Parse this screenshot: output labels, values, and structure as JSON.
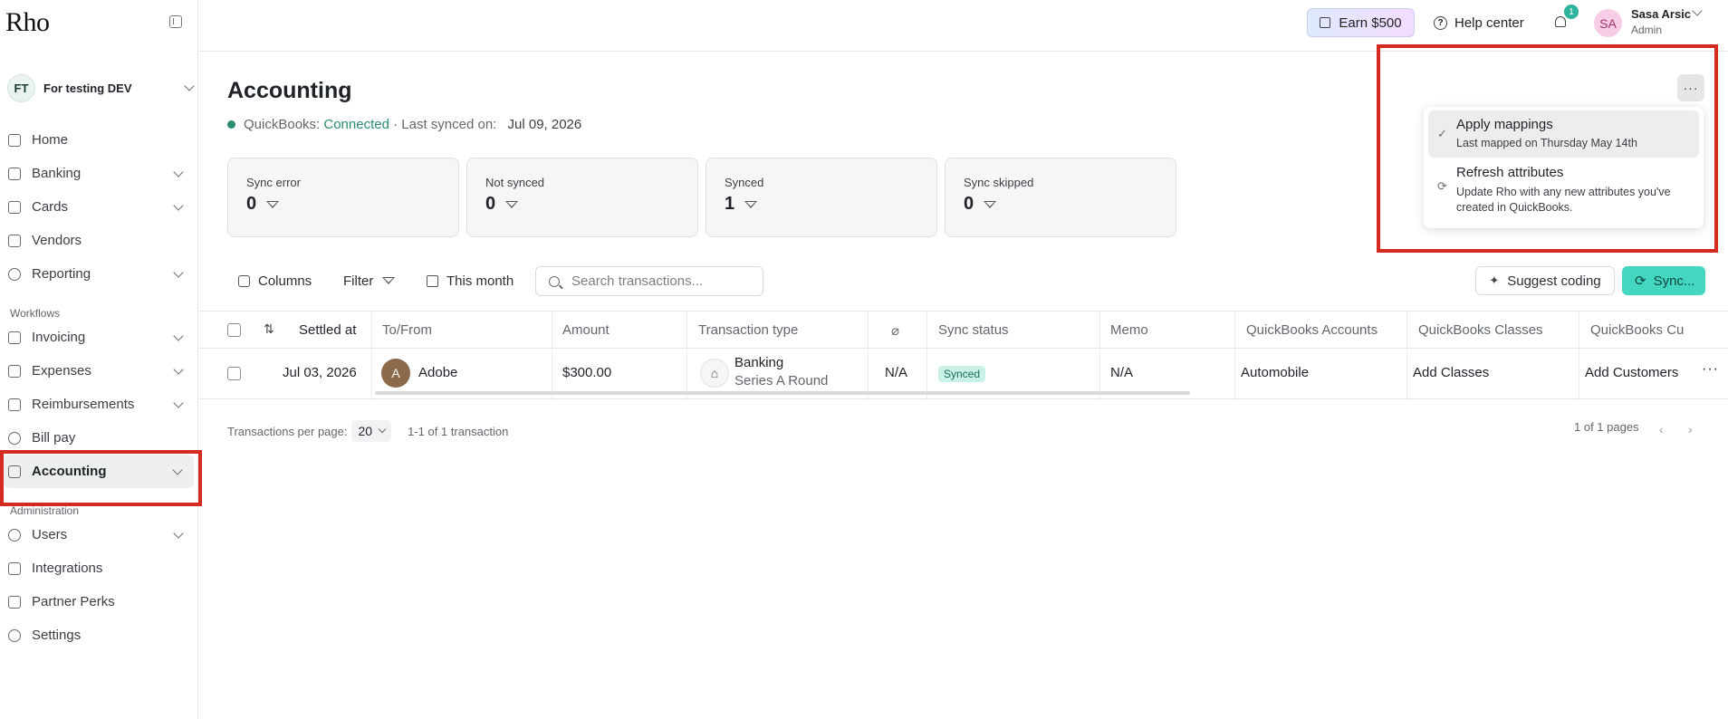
{
  "app": {
    "logo": "Rho"
  },
  "org": {
    "initials": "FT",
    "name": "For testing DEV"
  },
  "sidebar": {
    "items": [
      {
        "label": "Home"
      },
      {
        "label": "Banking"
      },
      {
        "label": "Cards"
      },
      {
        "label": "Vendors"
      },
      {
        "label": "Reporting"
      }
    ],
    "workflows_label": "Workflows",
    "workflow_items": [
      {
        "label": "Invoicing"
      },
      {
        "label": "Expenses"
      },
      {
        "label": "Reimbursements"
      },
      {
        "label": "Bill pay"
      },
      {
        "label": "Accounting"
      }
    ],
    "admin_label": "Administration",
    "admin_items": [
      {
        "label": "Users"
      },
      {
        "label": "Integrations"
      },
      {
        "label": "Partner Perks"
      },
      {
        "label": "Settings"
      }
    ]
  },
  "topbar": {
    "earn_label": "Earn $500",
    "help_label": "Help center",
    "notification_count": "1",
    "user_initials": "SA",
    "user_name": "Sasa Arsic",
    "user_role": "Admin"
  },
  "page": {
    "title": "Accounting",
    "status_prefix": "QuickBooks: ",
    "status_value": "Connected",
    "status_suffix": " · Last synced on: ",
    "status_date": "Jul 09, 2026"
  },
  "cards": [
    {
      "title": "Sync error",
      "value": "0"
    },
    {
      "title": "Not synced",
      "value": "0"
    },
    {
      "title": "Synced",
      "value": "1"
    },
    {
      "title": "Sync skipped",
      "value": "0"
    }
  ],
  "toolbar": {
    "columns_label": "Columns",
    "filter_label": "Filter",
    "date_label": "This month",
    "search_placeholder": "Search transactions...",
    "suggest_label": "Suggest coding",
    "sync_label": "Sync..."
  },
  "table": {
    "headers": [
      "Settled at",
      "To/From",
      "Amount",
      "Transaction type",
      "Sync status",
      "Memo",
      "QuickBooks Accounts",
      "QuickBooks Classes",
      "QuickBooks Cu"
    ],
    "rows": [
      {
        "settled_at": "Jul 03, 2026",
        "vendor_initial": "A",
        "to_from": "Adobe",
        "amount": "$300.00",
        "type": "Banking",
        "type_sub": "Series A Round",
        "attachment": "N/A",
        "sync_status": "Synced",
        "memo": "N/A",
        "qb_account": "Automobile",
        "qb_class": "Add Classes",
        "qb_customer": "Add Customers"
      }
    ]
  },
  "pagination": {
    "per_page_label": "Transactions per page:",
    "per_page_value": "20",
    "range": "1-1 of 1 transaction",
    "pages": "1 of 1 pages"
  },
  "menu": {
    "items": [
      {
        "title": "Apply mappings",
        "subtitle": "Last mapped on Thursday May 14th"
      },
      {
        "title": "Refresh attributes",
        "subtitle": "Update Rho with any new attributes you've created in QuickBooks."
      }
    ]
  },
  "colors": {
    "accent": "#43d6c1",
    "connected": "#2a8c73",
    "annotation": "#d52b1e"
  }
}
